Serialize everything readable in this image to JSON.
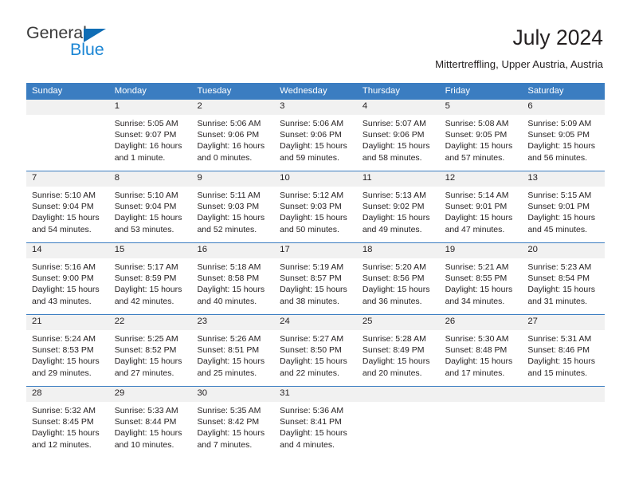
{
  "logo": {
    "primary_text": "General",
    "secondary_text": "Blue",
    "triangle_color": "#0f6db5",
    "secondary_color": "#1c86d4"
  },
  "header": {
    "title": "July 2024",
    "subtitle": "Mittertreffling, Upper Austria, Austria"
  },
  "theme": {
    "header_blue": "#3b7dc1",
    "day_band_gray": "#f1f1f1",
    "text": "#231f20"
  },
  "calendar": {
    "weekday_headers": [
      "Sunday",
      "Monday",
      "Tuesday",
      "Wednesday",
      "Thursday",
      "Friday",
      "Saturday"
    ],
    "labels": {
      "sunrise": "Sunrise:",
      "sunset": "Sunset:",
      "daylight": "Daylight:"
    },
    "weeks": [
      [
        {
          "day": ""
        },
        {
          "day": "1",
          "sunrise": "Sunrise: 5:05 AM",
          "sunset": "Sunset: 9:07 PM",
          "daylight": "Daylight: 16 hours and 1 minute."
        },
        {
          "day": "2",
          "sunrise": "Sunrise: 5:06 AM",
          "sunset": "Sunset: 9:06 PM",
          "daylight": "Daylight: 16 hours and 0 minutes."
        },
        {
          "day": "3",
          "sunrise": "Sunrise: 5:06 AM",
          "sunset": "Sunset: 9:06 PM",
          "daylight": "Daylight: 15 hours and 59 minutes."
        },
        {
          "day": "4",
          "sunrise": "Sunrise: 5:07 AM",
          "sunset": "Sunset: 9:06 PM",
          "daylight": "Daylight: 15 hours and 58 minutes."
        },
        {
          "day": "5",
          "sunrise": "Sunrise: 5:08 AM",
          "sunset": "Sunset: 9:05 PM",
          "daylight": "Daylight: 15 hours and 57 minutes."
        },
        {
          "day": "6",
          "sunrise": "Sunrise: 5:09 AM",
          "sunset": "Sunset: 9:05 PM",
          "daylight": "Daylight: 15 hours and 56 minutes."
        }
      ],
      [
        {
          "day": "7",
          "sunrise": "Sunrise: 5:10 AM",
          "sunset": "Sunset: 9:04 PM",
          "daylight": "Daylight: 15 hours and 54 minutes."
        },
        {
          "day": "8",
          "sunrise": "Sunrise: 5:10 AM",
          "sunset": "Sunset: 9:04 PM",
          "daylight": "Daylight: 15 hours and 53 minutes."
        },
        {
          "day": "9",
          "sunrise": "Sunrise: 5:11 AM",
          "sunset": "Sunset: 9:03 PM",
          "daylight": "Daylight: 15 hours and 52 minutes."
        },
        {
          "day": "10",
          "sunrise": "Sunrise: 5:12 AM",
          "sunset": "Sunset: 9:03 PM",
          "daylight": "Daylight: 15 hours and 50 minutes."
        },
        {
          "day": "11",
          "sunrise": "Sunrise: 5:13 AM",
          "sunset": "Sunset: 9:02 PM",
          "daylight": "Daylight: 15 hours and 49 minutes."
        },
        {
          "day": "12",
          "sunrise": "Sunrise: 5:14 AM",
          "sunset": "Sunset: 9:01 PM",
          "daylight": "Daylight: 15 hours and 47 minutes."
        },
        {
          "day": "13",
          "sunrise": "Sunrise: 5:15 AM",
          "sunset": "Sunset: 9:01 PM",
          "daylight": "Daylight: 15 hours and 45 minutes."
        }
      ],
      [
        {
          "day": "14",
          "sunrise": "Sunrise: 5:16 AM",
          "sunset": "Sunset: 9:00 PM",
          "daylight": "Daylight: 15 hours and 43 minutes."
        },
        {
          "day": "15",
          "sunrise": "Sunrise: 5:17 AM",
          "sunset": "Sunset: 8:59 PM",
          "daylight": "Daylight: 15 hours and 42 minutes."
        },
        {
          "day": "16",
          "sunrise": "Sunrise: 5:18 AM",
          "sunset": "Sunset: 8:58 PM",
          "daylight": "Daylight: 15 hours and 40 minutes."
        },
        {
          "day": "17",
          "sunrise": "Sunrise: 5:19 AM",
          "sunset": "Sunset: 8:57 PM",
          "daylight": "Daylight: 15 hours and 38 minutes."
        },
        {
          "day": "18",
          "sunrise": "Sunrise: 5:20 AM",
          "sunset": "Sunset: 8:56 PM",
          "daylight": "Daylight: 15 hours and 36 minutes."
        },
        {
          "day": "19",
          "sunrise": "Sunrise: 5:21 AM",
          "sunset": "Sunset: 8:55 PM",
          "daylight": "Daylight: 15 hours and 34 minutes."
        },
        {
          "day": "20",
          "sunrise": "Sunrise: 5:23 AM",
          "sunset": "Sunset: 8:54 PM",
          "daylight": "Daylight: 15 hours and 31 minutes."
        }
      ],
      [
        {
          "day": "21",
          "sunrise": "Sunrise: 5:24 AM",
          "sunset": "Sunset: 8:53 PM",
          "daylight": "Daylight: 15 hours and 29 minutes."
        },
        {
          "day": "22",
          "sunrise": "Sunrise: 5:25 AM",
          "sunset": "Sunset: 8:52 PM",
          "daylight": "Daylight: 15 hours and 27 minutes."
        },
        {
          "day": "23",
          "sunrise": "Sunrise: 5:26 AM",
          "sunset": "Sunset: 8:51 PM",
          "daylight": "Daylight: 15 hours and 25 minutes."
        },
        {
          "day": "24",
          "sunrise": "Sunrise: 5:27 AM",
          "sunset": "Sunset: 8:50 PM",
          "daylight": "Daylight: 15 hours and 22 minutes."
        },
        {
          "day": "25",
          "sunrise": "Sunrise: 5:28 AM",
          "sunset": "Sunset: 8:49 PM",
          "daylight": "Daylight: 15 hours and 20 minutes."
        },
        {
          "day": "26",
          "sunrise": "Sunrise: 5:30 AM",
          "sunset": "Sunset: 8:48 PM",
          "daylight": "Daylight: 15 hours and 17 minutes."
        },
        {
          "day": "27",
          "sunrise": "Sunrise: 5:31 AM",
          "sunset": "Sunset: 8:46 PM",
          "daylight": "Daylight: 15 hours and 15 minutes."
        }
      ],
      [
        {
          "day": "28",
          "sunrise": "Sunrise: 5:32 AM",
          "sunset": "Sunset: 8:45 PM",
          "daylight": "Daylight: 15 hours and 12 minutes."
        },
        {
          "day": "29",
          "sunrise": "Sunrise: 5:33 AM",
          "sunset": "Sunset: 8:44 PM",
          "daylight": "Daylight: 15 hours and 10 minutes."
        },
        {
          "day": "30",
          "sunrise": "Sunrise: 5:35 AM",
          "sunset": "Sunset: 8:42 PM",
          "daylight": "Daylight: 15 hours and 7 minutes."
        },
        {
          "day": "31",
          "sunrise": "Sunrise: 5:36 AM",
          "sunset": "Sunset: 8:41 PM",
          "daylight": "Daylight: 15 hours and 4 minutes."
        },
        {
          "day": ""
        },
        {
          "day": ""
        },
        {
          "day": ""
        }
      ]
    ]
  }
}
